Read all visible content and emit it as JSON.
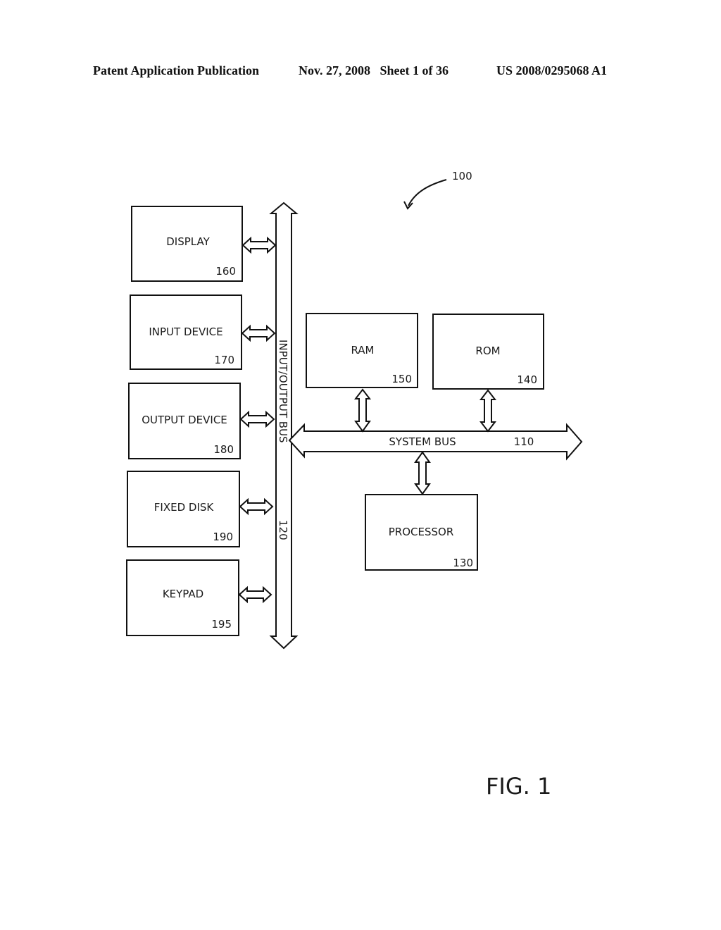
{
  "header": {
    "publication": "Patent Application Publication",
    "date_sheet": "Nov. 27, 2008   Sheet 1 of 36",
    "number": "US 2008/0295068 A1"
  },
  "figure": {
    "ref": "100",
    "caption": "FIG. 1",
    "io_bus": {
      "label": "INPUT/OUTPUT BUS",
      "ref": "120"
    },
    "system_bus": {
      "label": "SYSTEM BUS",
      "ref": "110"
    },
    "io_devices": [
      {
        "label": "DISPLAY",
        "ref": "160"
      },
      {
        "label": "INPUT DEVICE",
        "ref": "170"
      },
      {
        "label": "OUTPUT DEVICE",
        "ref": "180"
      },
      {
        "label": "FIXED DISK",
        "ref": "190"
      },
      {
        "label": "KEYPAD",
        "ref": "195"
      }
    ],
    "memory": [
      {
        "label": "RAM",
        "ref": "150"
      },
      {
        "label": "ROM",
        "ref": "140"
      }
    ],
    "processor": {
      "label": "PROCESSOR",
      "ref": "130"
    }
  }
}
